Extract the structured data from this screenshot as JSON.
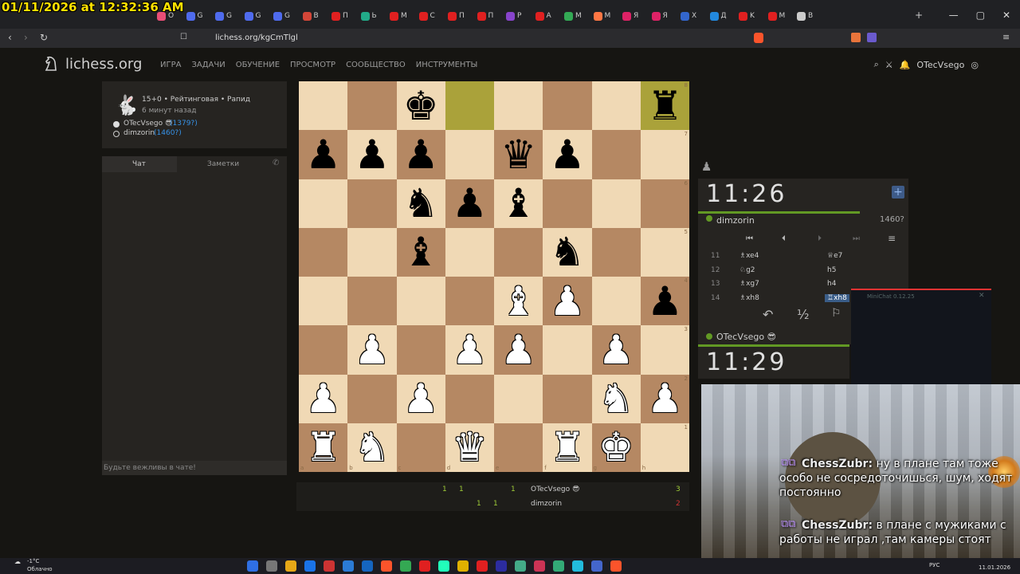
{
  "timestamp": "01/11/2026 at 12:32:36 AM",
  "browser": {
    "tabs": [
      "O",
      "G",
      "G",
      "G",
      "G",
      "B",
      "П",
      "Ь",
      "M",
      "C",
      "П",
      "П",
      "P",
      "A",
      "M",
      "M",
      "Я",
      "Я",
      "X",
      "Д",
      "K",
      "M",
      "В"
    ],
    "tab_colors": [
      "#e94e77",
      "#4f6bed",
      "#4f6bed",
      "#4f6bed",
      "#4f6bed",
      "#d44638",
      "#e02020",
      "#22aa88",
      "#e02020",
      "#e02020",
      "#e02020",
      "#e02020",
      "#8844cc",
      "#e02020",
      "#33aa55",
      "#ff7744",
      "#dd2266",
      "#dd2266",
      "#3366cc",
      "#2288dd",
      "#e02020",
      "#e02020",
      "#cccccc"
    ],
    "url": "lichess.org/kgCmTlgl",
    "new_tab": "+"
  },
  "site": {
    "logo_text": "lichess.org",
    "nav": [
      "ИГРА",
      "ЗАДАЧИ",
      "ОБУЧЕНИЕ",
      "ПРОСМОТР",
      "СООБЩЕСТВО",
      "ИНСТРУМЕНТЫ"
    ],
    "username": "OTecVsego"
  },
  "game_info": {
    "setup": "15+0 • Рейтинговая • Рапид",
    "time_ago": "6 минут назад",
    "white_player": "OTecVsego 😎",
    "white_rating": "(1379?)",
    "black_player": "dimzorin",
    "black_rating": "(1460?)"
  },
  "chat": {
    "tab_chat": "Чат",
    "tab_notes": "Заметки",
    "placeholder": "Будьте вежливы в чате!"
  },
  "board": {
    "ranks": [
      [
        "",
        "",
        "bk",
        "",
        "",
        "",
        "",
        "br"
      ],
      [
        "bp",
        "bp",
        "bp",
        "",
        "bq",
        "bp",
        "",
        ""
      ],
      [
        "",
        "",
        "bn",
        "bp",
        "bb",
        "",
        "",
        ""
      ],
      [
        "",
        "",
        "bb",
        "",
        "",
        "bn",
        "",
        ""
      ],
      [
        "",
        "",
        "",
        "",
        "wb",
        "wp",
        "",
        "bp"
      ],
      [
        "",
        "wp",
        "",
        "wp",
        "wp",
        "",
        "wp",
        ""
      ],
      [
        "wp",
        "",
        "wp",
        "",
        "",
        "",
        "wn",
        "wp"
      ],
      [
        "wr",
        "wn",
        "",
        "wq",
        "",
        "wr",
        "wk",
        ""
      ]
    ],
    "highlighted": [
      "d8",
      "h8"
    ],
    "rank_labels": [
      "8",
      "7",
      "6",
      "5",
      "4",
      "3",
      "2",
      "1"
    ],
    "file_labels": [
      "a",
      "b",
      "c",
      "d",
      "e",
      "f",
      "g",
      "h"
    ]
  },
  "clocks": {
    "top_time": "11:26",
    "top_player": "dimzorin",
    "top_rating": "1460?",
    "bottom_time": "11:29",
    "bottom_player": "OTecVsego 😎"
  },
  "moves": [
    {
      "num": "11",
      "white": "♗xe4",
      "black": "♕e7"
    },
    {
      "num": "12",
      "white": "♘g2",
      "black": "h5"
    },
    {
      "num": "13",
      "white": "♗xg7",
      "black": "h4"
    },
    {
      "num": "14",
      "white": "♗xh8",
      "black": "♖xh8"
    }
  ],
  "controls": {
    "draw": "½"
  },
  "result_table": {
    "white_scores": [
      "1",
      "1",
      "",
      "",
      "1"
    ],
    "black_scores": [
      "",
      "",
      "1",
      "1",
      ""
    ],
    "white_name": "OTecVsego 😎",
    "white_total": "3",
    "black_name": "dimzorin",
    "black_total": "2"
  },
  "minichat_title": "MiniChat 0.12.25",
  "twitch_chat": [
    {
      "user": "ChessZubr:",
      "text": "ну в плане там тоже особо не сосредоточишься, шум, ходят постоянно"
    },
    {
      "user": "ChessZubr:",
      "text": "в плане с мужиками с работы не играл ,там камеры стоят"
    }
  ],
  "taskbar": {
    "weather_temp": "-1°C",
    "weather_desc": "Облачно",
    "lang": "РУС",
    "date": "11.01.2026"
  }
}
